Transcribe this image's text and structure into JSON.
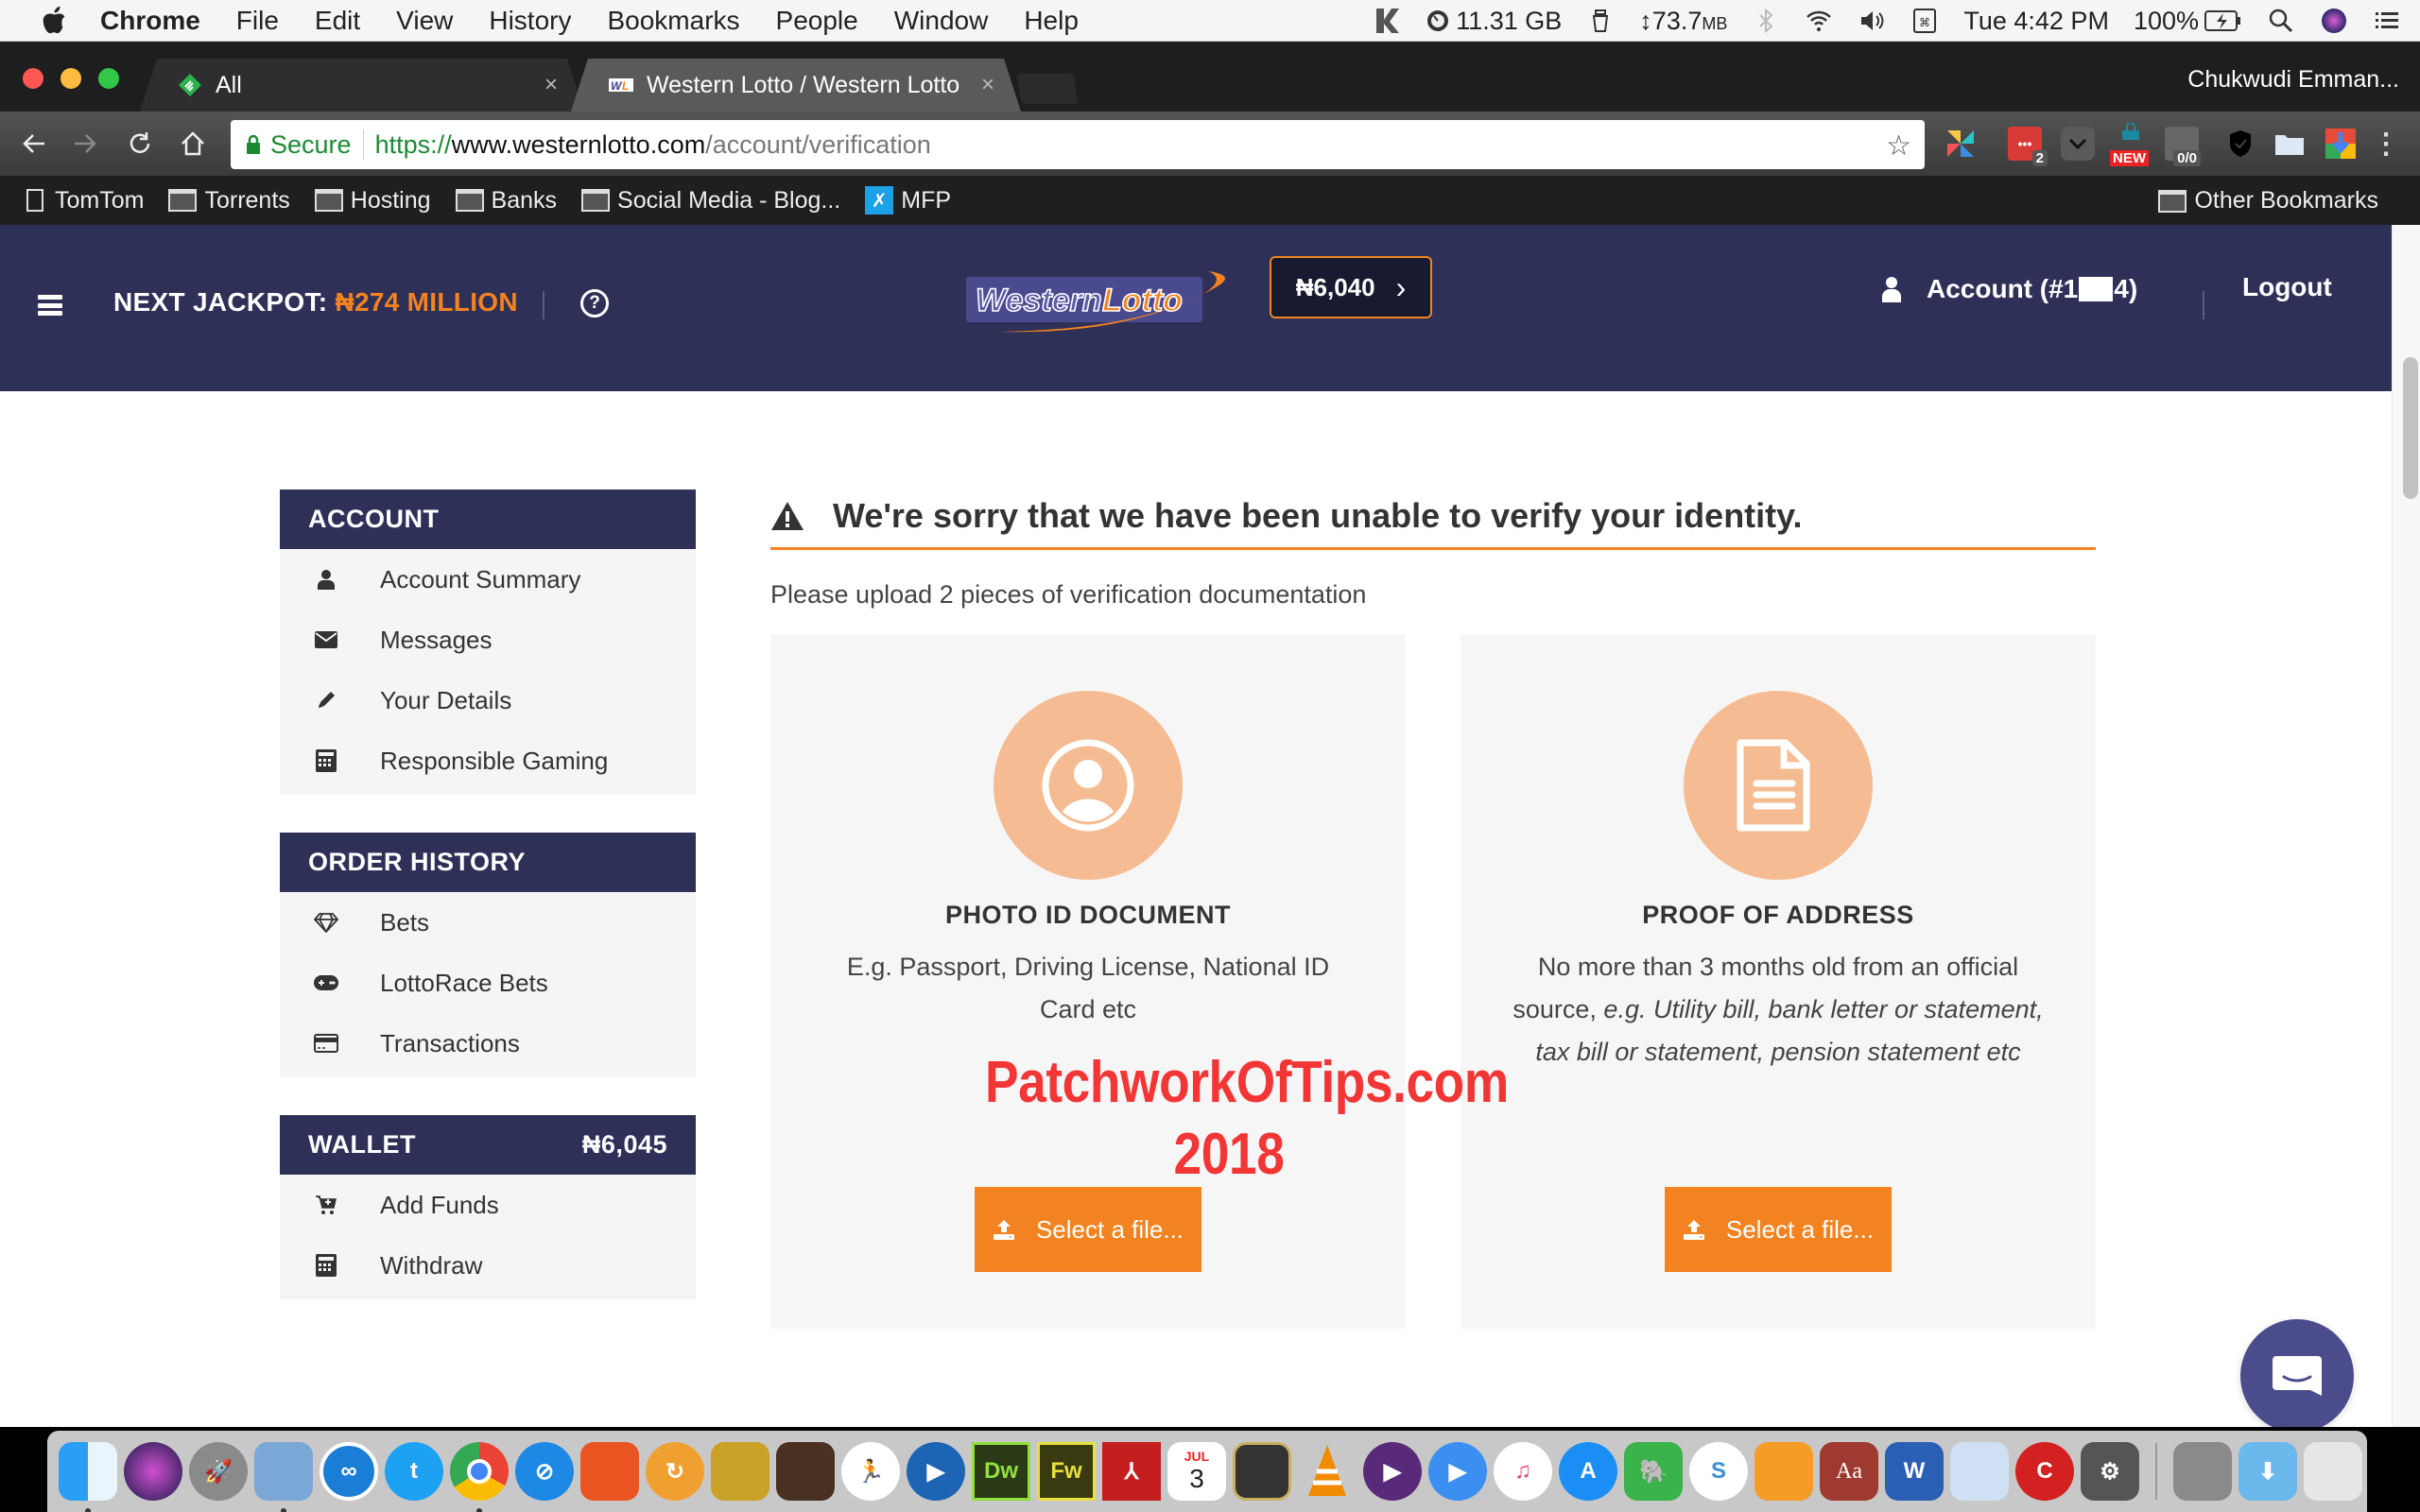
{
  "menubar": {
    "app_name": "Chrome",
    "items": [
      "File",
      "Edit",
      "View",
      "History",
      "Bookmarks",
      "People",
      "Window",
      "Help"
    ],
    "status": {
      "memory": "11.31 GB",
      "network_value": "↕73.7",
      "network_unit": "MB",
      "clock": "Tue 4:42 PM",
      "battery": "100%"
    }
  },
  "browser": {
    "tabs": [
      {
        "title": "All",
        "active": false
      },
      {
        "title": "Western Lotto / Western Lotto",
        "active": true
      }
    ],
    "close_glyph": "×",
    "profile_name": "Chukwudi Emman...",
    "omnibox": {
      "secure_label": "Secure",
      "scheme": "https://",
      "host": "www.westernlotto.com",
      "path": "/account/verification"
    },
    "extensions": [
      {
        "name": "pinwheel",
        "badge": ""
      },
      {
        "name": "lastpass",
        "badge": "2"
      },
      {
        "name": "pocket",
        "badge": ""
      },
      {
        "name": "shopping",
        "badge": "NEW"
      },
      {
        "name": "parrot",
        "badge": "0/0"
      },
      {
        "name": "shield",
        "badge": ""
      },
      {
        "name": "folder",
        "badge": ""
      },
      {
        "name": "downloader",
        "badge": ""
      }
    ],
    "bookmarks": [
      {
        "label": "TomTom",
        "type": "page"
      },
      {
        "label": "Torrents",
        "type": "folder"
      },
      {
        "label": "Hosting",
        "type": "folder"
      },
      {
        "label": "Banks",
        "type": "folder"
      },
      {
        "label": "Social Media - Blog...",
        "type": "folder"
      },
      {
        "label": "MFP",
        "type": "app"
      }
    ],
    "other_bookmarks": "Other Bookmarks"
  },
  "site": {
    "header": {
      "jackpot_label": "NEXT JACKPOT:",
      "jackpot_amount": "₦274 MILLION",
      "help_glyph": "?",
      "logo_western": "Western",
      "logo_lotto": "Lotto",
      "balance": "₦6,040",
      "balance_chevron": "›",
      "account_prefix": "Account (#1",
      "account_suffix": "4)",
      "logout": "Logout"
    },
    "sidebar": {
      "groups": [
        {
          "title": "ACCOUNT",
          "value": "",
          "items": [
            {
              "label": "Account Summary",
              "icon": "user-icon"
            },
            {
              "label": "Messages",
              "icon": "envelope-icon"
            },
            {
              "label": "Your Details",
              "icon": "pencil-icon"
            },
            {
              "label": "Responsible Gaming",
              "icon": "calculator-icon"
            }
          ]
        },
        {
          "title": "ORDER HISTORY",
          "value": "",
          "items": [
            {
              "label": "Bets",
              "icon": "diamond-icon"
            },
            {
              "label": "LottoRace Bets",
              "icon": "gamepad-icon"
            },
            {
              "label": "Transactions",
              "icon": "credit-card-icon"
            }
          ]
        },
        {
          "title": "WALLET",
          "value": "₦6,045",
          "items": [
            {
              "label": "Add Funds",
              "icon": "cart-plus-icon"
            },
            {
              "label": "Withdraw",
              "icon": "calculator-icon"
            }
          ]
        }
      ]
    },
    "main": {
      "alert_title": "We're sorry that we have been unable to verify your identity.",
      "subtitle": "Please upload 2 pieces of verification documentation",
      "cards": [
        {
          "title": "PHOTO ID DOCUMENT",
          "desc_plain": "E.g. Passport, Driving License, National ID Card etc",
          "desc_italic": "",
          "button": "Select a file..."
        },
        {
          "title": "PROOF OF ADDRESS",
          "desc_plain": "No more than 3 months old from an official source, ",
          "desc_italic": "e.g. Utility bill, bank letter or statement, tax bill or statement, pension statement etc",
          "button": "Select a file..."
        }
      ]
    },
    "watermark": {
      "line1": "PatchworkOfTips.com",
      "line2": "2018"
    }
  },
  "colors": {
    "navy": "#2f3057",
    "orange": "#f38321",
    "peach": "#f5bc93",
    "card_bg": "#f6f6f6",
    "watermark_red": "#f23636"
  },
  "dock": {
    "calendar_month": "JUL",
    "calendar_day": "3",
    "apps": [
      "Finder",
      "Siri",
      "Launchpad",
      "Mail",
      "VPN",
      "Twitter",
      "Chrome",
      "Safari",
      "Transmit",
      "Sync",
      "Forklift",
      "Image Capture",
      "Running",
      "Movie Player Pro",
      "Dreamweaver",
      "Fireworks",
      "Acrobat",
      "Calendar",
      "Speaker",
      "VLC",
      "Podcast",
      "Player",
      "iTunes",
      "App Store",
      "Evernote",
      "Simplenote",
      "iBooks",
      "Dictionary",
      "Word",
      "TextEdit",
      "CCleaner",
      "System Preferences",
      "Disk",
      "Downloads",
      "Trash"
    ]
  }
}
